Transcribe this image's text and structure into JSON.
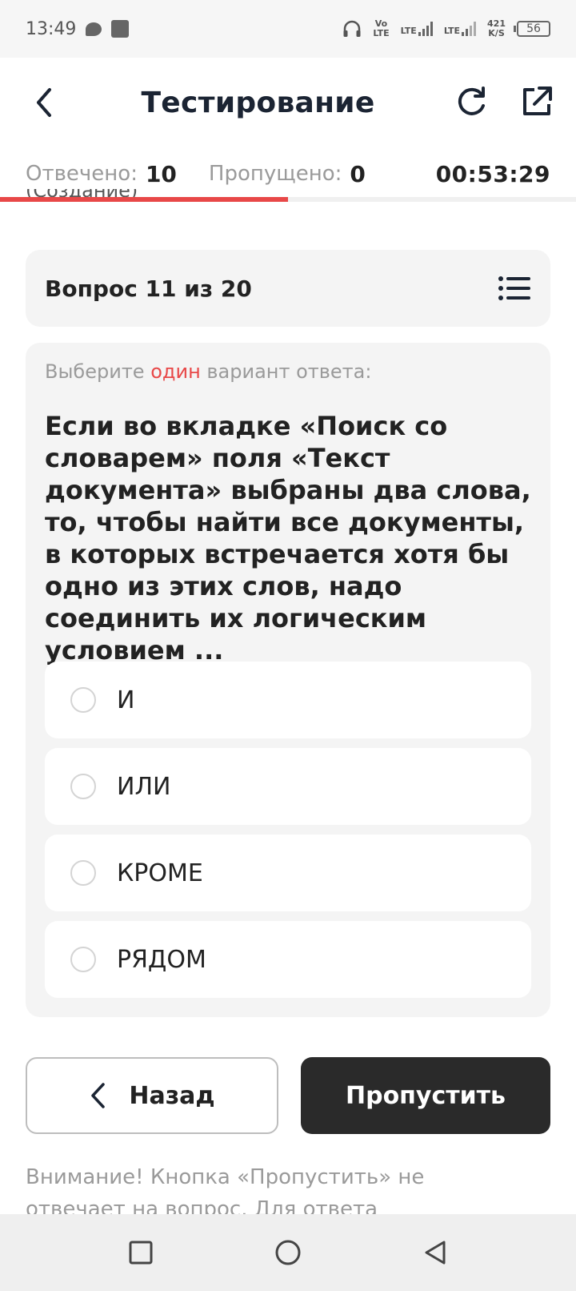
{
  "status_bar": {
    "time": "13:49",
    "volte": [
      "Vo",
      "LTE"
    ],
    "lte1": "LTE",
    "lte2": "LTE",
    "speed": [
      "421",
      "K/S"
    ],
    "battery": "56"
  },
  "header": {
    "title": "Тестирование"
  },
  "stats": {
    "answered_label": "Отвечено:",
    "answered_value": "10",
    "skipped_label": "Пропущено:",
    "skipped_value": "0",
    "timer": "00:53:29",
    "progress_fraction": 0.5
  },
  "overlap_text": "(Создание)",
  "question": {
    "counter": "Вопрос 11 из 20",
    "hint_before": "Выберите ",
    "hint_accent": "один",
    "hint_after": " вариант ответа:",
    "text": "Если во вкладке «Поиск со словарем» поля «Текст документа» выбраны два слова, то, чтобы найти все документы, в которых встречается хотя бы одно из этих слов, надо соединить их логическим условием ...",
    "options": [
      {
        "label": "И"
      },
      {
        "label": "ИЛИ"
      },
      {
        "label": "КРОМЕ"
      },
      {
        "label": "РЯДОМ"
      }
    ]
  },
  "buttons": {
    "back": "Назад",
    "skip": "Пропустить"
  },
  "warning": "Внимание! Кнопка «Пропустить» не отвечает на вопрос. Для ответа",
  "colors": {
    "accent": "#e84848",
    "dark_button": "#2a2a2a",
    "card_bg": "#f4f4f4"
  }
}
